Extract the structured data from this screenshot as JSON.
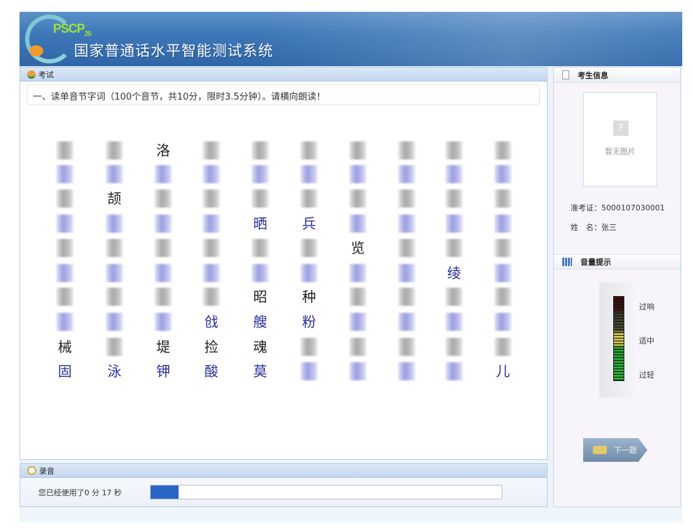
{
  "header": {
    "logo": "PSCP",
    "logo_version": "25",
    "title": "国家普通话水平智能测试系统"
  },
  "exam": {
    "section_label": "考试",
    "question": "一、读单音节字词（100个音节，共10分，限时3.5分钟）。请横向朗读！",
    "rows": [
      [
        "",
        "",
        "洛",
        "",
        "",
        "",
        "",
        "",
        "",
        ""
      ],
      [
        "",
        "",
        "",
        "",
        "",
        "",
        "",
        "",
        "",
        ""
      ],
      [
        "",
        "颉",
        "",
        "",
        "",
        "",
        "",
        "",
        "",
        ""
      ],
      [
        "",
        "",
        "",
        "",
        "晒",
        "兵",
        "",
        "",
        "",
        ""
      ],
      [
        "",
        "",
        "",
        "",
        "",
        "",
        "览",
        "",
        "",
        ""
      ],
      [
        "",
        "",
        "",
        "",
        "",
        "",
        "",
        "",
        "绫",
        ""
      ],
      [
        "",
        "",
        "",
        "",
        "昭",
        "种",
        "",
        "",
        "",
        ""
      ],
      [
        "",
        "",
        "",
        "戗",
        "艘",
        "粉",
        "",
        "",
        "",
        ""
      ],
      [
        "械",
        "",
        "堤",
        "捡",
        "魂",
        "",
        "",
        "",
        "",
        ""
      ],
      [
        "固",
        "泳",
        "钾",
        "酸",
        "莫",
        "",
        "",
        "",
        "",
        "儿"
      ]
    ]
  },
  "recording": {
    "section_label": "录音",
    "used_prefix": "您已经使用了",
    "minutes": "0",
    "min_unit": "分",
    "seconds": "17",
    "sec_unit": "秒",
    "progress_fraction": 0.08
  },
  "candidate": {
    "section_label": "考生信息",
    "no_photo": "暂无图片",
    "photo_icon": "?",
    "id_label": "准考证：",
    "id_value": "5000107030001",
    "name_label": "姓　名：",
    "name_value": "张三"
  },
  "volume": {
    "section_label": "音量提示",
    "high": "过响",
    "mid": "适中",
    "low": "过轻"
  },
  "next_button": "下一题",
  "colors": {
    "header": "#3f78b8",
    "progress": "#2a66c6",
    "char_blue": "#2a2fa0"
  }
}
